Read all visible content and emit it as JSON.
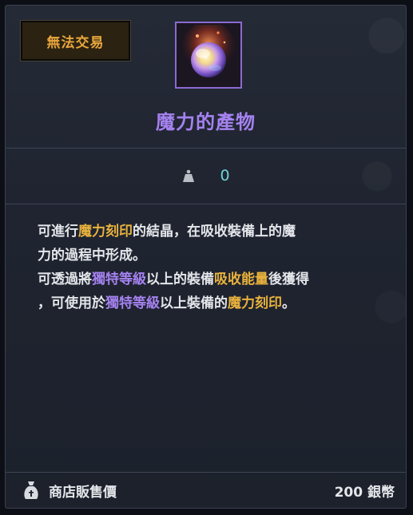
{
  "trade_badge": "無法交易",
  "item": {
    "name": "魔力的產物",
    "icon": "magic-crystal-orb-icon"
  },
  "weight": {
    "icon": "weight-icon",
    "value": "0"
  },
  "description": {
    "line1": [
      {
        "text": "可進行",
        "style": "normal"
      },
      {
        "text": "魔力刻印",
        "style": "gold"
      },
      {
        "text": "的結晶，在吸收裝備上的魔",
        "style": "normal"
      }
    ],
    "line2": [
      {
        "text": "力的過程中形成。",
        "style": "normal"
      }
    ],
    "line3": [
      {
        "text": "可透過將",
        "style": "normal"
      },
      {
        "text": "獨特等級",
        "style": "purple"
      },
      {
        "text": "以上的裝備",
        "style": "normal"
      },
      {
        "text": "吸收能量",
        "style": "gold"
      },
      {
        "text": "後獲得",
        "style": "normal"
      }
    ],
    "line4": [
      {
        "text": "，可使用於",
        "style": "normal"
      },
      {
        "text": "獨特等級",
        "style": "purple"
      },
      {
        "text": "以上裝備的",
        "style": "normal"
      },
      {
        "text": "魔力刻印",
        "style": "gold"
      },
      {
        "text": "。",
        "style": "normal"
      }
    ]
  },
  "footer": {
    "label": "商店販售價",
    "price": "200 銀幣",
    "icon": "money-bag-icon"
  },
  "colors": {
    "gold": "#e9b23d",
    "purple": "#a582f0",
    "cyan": "#6fd4d6",
    "text": "#e4e6ea"
  }
}
